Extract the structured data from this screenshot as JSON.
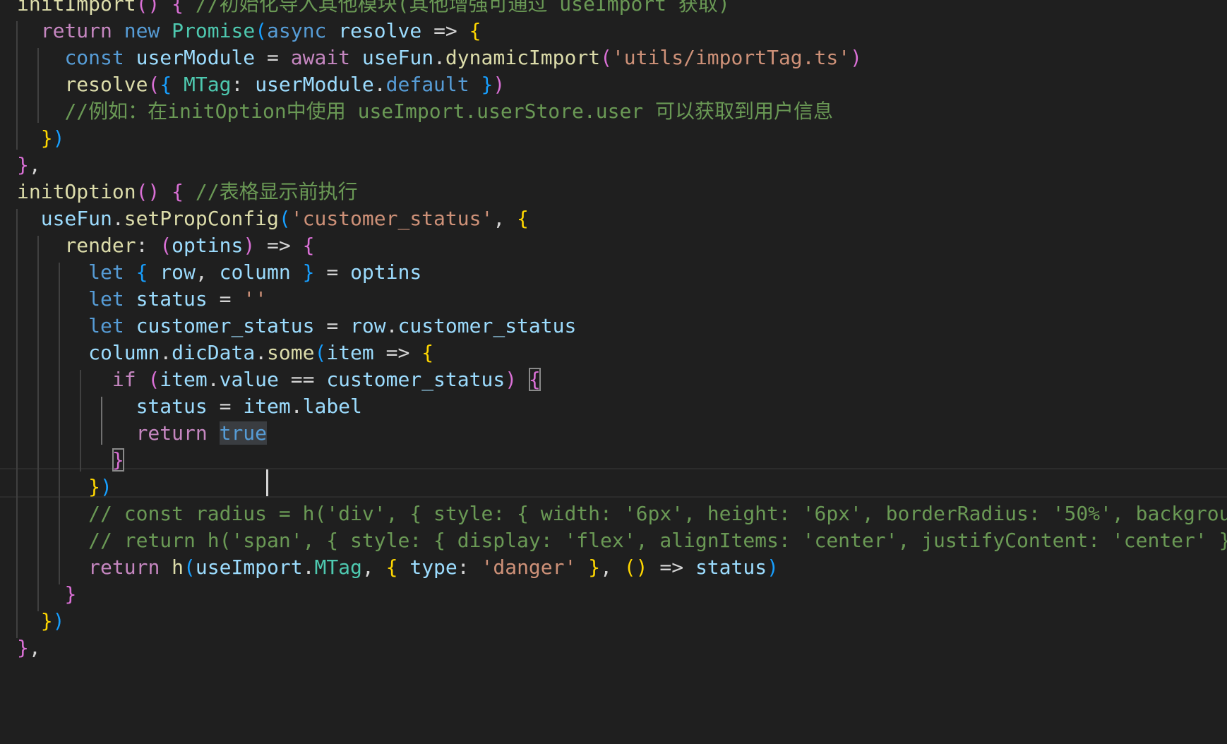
{
  "theme": {
    "background": "#1f1f1f",
    "colors": {
      "function": "#dcdcaa",
      "keyword": "#569cd6",
      "control": "#c586c0",
      "string": "#ce9178",
      "comment": "#6a9955",
      "variable": "#9cdcfe",
      "type": "#4ec9b0",
      "plain": "#d4d4d4",
      "bracket_level_1": "#ffd700",
      "bracket_level_2": "#da70d6",
      "bracket_level_3": "#179fff"
    }
  },
  "editor": {
    "active_line": 17,
    "selection": "true",
    "matched_bracket_lines": [
      15,
      18
    ],
    "lines": [
      [
        {
          "t": "initImport",
          "c": "fn"
        },
        {
          "t": "()",
          "c": "b2"
        },
        {
          "t": " "
        },
        {
          "t": "{",
          "c": "b2"
        },
        {
          "t": " "
        },
        {
          "t": "//初始化导入其他模块(其他增强可通过 useImport 获取)",
          "c": "cmt"
        }
      ],
      [
        {
          "t": "  "
        },
        {
          "t": "return",
          "c": "ctrl"
        },
        {
          "t": " "
        },
        {
          "t": "new",
          "c": "kw"
        },
        {
          "t": " "
        },
        {
          "t": "Promise",
          "c": "type"
        },
        {
          "t": "(",
          "c": "b3"
        },
        {
          "t": "async",
          "c": "kw"
        },
        {
          "t": " "
        },
        {
          "t": "resolve",
          "c": "var"
        },
        {
          "t": " => "
        },
        {
          "t": "{",
          "c": "b1"
        }
      ],
      [
        {
          "t": "    "
        },
        {
          "t": "const",
          "c": "kw"
        },
        {
          "t": " "
        },
        {
          "t": "userModule",
          "c": "var"
        },
        {
          "t": " = "
        },
        {
          "t": "await",
          "c": "ctrl"
        },
        {
          "t": " "
        },
        {
          "t": "useFun",
          "c": "var"
        },
        {
          "t": "."
        },
        {
          "t": "dynamicImport",
          "c": "fn"
        },
        {
          "t": "(",
          "c": "b2"
        },
        {
          "t": "'utils/importTag.ts'",
          "c": "str"
        },
        {
          "t": ")",
          "c": "b2"
        }
      ],
      [
        {
          "t": "    "
        },
        {
          "t": "resolve",
          "c": "fn"
        },
        {
          "t": "(",
          "c": "b2"
        },
        {
          "t": "{",
          "c": "b3"
        },
        {
          "t": " "
        },
        {
          "t": "MTag",
          "c": "type"
        },
        {
          "t": ": "
        },
        {
          "t": "userModule",
          "c": "var"
        },
        {
          "t": "."
        },
        {
          "t": "default",
          "c": "kw"
        },
        {
          "t": " "
        },
        {
          "t": "}",
          "c": "b3"
        },
        {
          "t": ")",
          "c": "b2"
        }
      ],
      [
        {
          "t": "    "
        },
        {
          "t": "//例如：在initOption中使用 useImport.userStore.user 可以获取到用户信息",
          "c": "cmt"
        }
      ],
      [
        {
          "t": "  "
        },
        {
          "t": "}",
          "c": "b1"
        },
        {
          "t": ")",
          "c": "b3"
        }
      ],
      [
        {
          "t": "}",
          "c": "b2"
        },
        {
          "t": ","
        }
      ],
      [
        {
          "t": "initOption",
          "c": "fn"
        },
        {
          "t": "()",
          "c": "b2"
        },
        {
          "t": " "
        },
        {
          "t": "{",
          "c": "b2"
        },
        {
          "t": " "
        },
        {
          "t": "//表格显示前执行",
          "c": "cmt"
        }
      ],
      [
        {
          "t": "  "
        },
        {
          "t": "useFun",
          "c": "var"
        },
        {
          "t": "."
        },
        {
          "t": "setPropConfig",
          "c": "fn"
        },
        {
          "t": "(",
          "c": "b3"
        },
        {
          "t": "'customer_status'",
          "c": "str"
        },
        {
          "t": ", "
        },
        {
          "t": "{",
          "c": "b1"
        }
      ],
      [
        {
          "t": "    "
        },
        {
          "t": "render",
          "c": "fn"
        },
        {
          "t": ": "
        },
        {
          "t": "(",
          "c": "b2"
        },
        {
          "t": "optins",
          "c": "var"
        },
        {
          "t": ")",
          "c": "b2"
        },
        {
          "t": " => "
        },
        {
          "t": "{",
          "c": "b2"
        }
      ],
      [
        {
          "t": "      "
        },
        {
          "t": "let",
          "c": "kw"
        },
        {
          "t": " "
        },
        {
          "t": "{",
          "c": "b3"
        },
        {
          "t": " "
        },
        {
          "t": "row",
          "c": "var"
        },
        {
          "t": ", "
        },
        {
          "t": "column",
          "c": "var"
        },
        {
          "t": " "
        },
        {
          "t": "}",
          "c": "b3"
        },
        {
          "t": " = "
        },
        {
          "t": "optins",
          "c": "var"
        }
      ],
      [
        {
          "t": "      "
        },
        {
          "t": "let",
          "c": "kw"
        },
        {
          "t": " "
        },
        {
          "t": "status",
          "c": "var"
        },
        {
          "t": " = "
        },
        {
          "t": "''",
          "c": "str"
        }
      ],
      [
        {
          "t": "      "
        },
        {
          "t": "let",
          "c": "kw"
        },
        {
          "t": " "
        },
        {
          "t": "customer_status",
          "c": "var"
        },
        {
          "t": " = "
        },
        {
          "t": "row",
          "c": "var"
        },
        {
          "t": "."
        },
        {
          "t": "customer_status",
          "c": "var"
        }
      ],
      [
        {
          "t": "      "
        },
        {
          "t": "column",
          "c": "var"
        },
        {
          "t": "."
        },
        {
          "t": "dicData",
          "c": "var"
        },
        {
          "t": "."
        },
        {
          "t": "some",
          "c": "fn"
        },
        {
          "t": "(",
          "c": "b3"
        },
        {
          "t": "item",
          "c": "var"
        },
        {
          "t": " => "
        },
        {
          "t": "{",
          "c": "b1"
        }
      ],
      [
        {
          "t": "        "
        },
        {
          "t": "if",
          "c": "ctrl"
        },
        {
          "t": " "
        },
        {
          "t": "(",
          "c": "b2"
        },
        {
          "t": "item",
          "c": "var"
        },
        {
          "t": "."
        },
        {
          "t": "value",
          "c": "var"
        },
        {
          "t": " == "
        },
        {
          "t": "customer_status",
          "c": "var"
        },
        {
          "t": ")",
          "c": "b2"
        },
        {
          "t": " "
        },
        {
          "t": "{",
          "c": "b2",
          "m": true
        }
      ],
      [
        {
          "t": "          "
        },
        {
          "t": "status",
          "c": "var"
        },
        {
          "t": " = "
        },
        {
          "t": "item",
          "c": "var"
        },
        {
          "t": "."
        },
        {
          "t": "label",
          "c": "var"
        }
      ],
      [
        {
          "t": "          "
        },
        {
          "t": "return",
          "c": "ctrl"
        },
        {
          "t": " "
        },
        {
          "t": "true",
          "c": "kw",
          "s": true
        }
      ],
      [
        {
          "t": "        "
        },
        {
          "t": "}",
          "c": "b2",
          "m": true
        }
      ],
      [
        {
          "t": "      "
        },
        {
          "t": "}",
          "c": "b1"
        },
        {
          "t": ")",
          "c": "b3"
        }
      ],
      [
        {
          "t": "      "
        },
        {
          "t": "// const radius = h('div', { style: { width: '6px', height: '6px', borderRadius: '50%', backgrou",
          "c": "cmt"
        }
      ],
      [
        {
          "t": "      "
        },
        {
          "t": "// return h('span', { style: { display: 'flex', alignItems: 'center', justifyContent: 'center' }",
          "c": "cmt"
        }
      ],
      [
        {
          "t": "      "
        },
        {
          "t": "return",
          "c": "ctrl"
        },
        {
          "t": " "
        },
        {
          "t": "h",
          "c": "fn"
        },
        {
          "t": "(",
          "c": "b3"
        },
        {
          "t": "useImport",
          "c": "var"
        },
        {
          "t": "."
        },
        {
          "t": "MTag",
          "c": "type"
        },
        {
          "t": ", "
        },
        {
          "t": "{",
          "c": "b1"
        },
        {
          "t": " "
        },
        {
          "t": "type",
          "c": "var"
        },
        {
          "t": ": "
        },
        {
          "t": "'danger'",
          "c": "str"
        },
        {
          "t": " "
        },
        {
          "t": "}",
          "c": "b1"
        },
        {
          "t": ", "
        },
        {
          "t": "()",
          "c": "b1"
        },
        {
          "t": " => "
        },
        {
          "t": "status",
          "c": "var"
        },
        {
          "t": ")",
          "c": "b3"
        }
      ],
      [
        {
          "t": "    "
        },
        {
          "t": "}",
          "c": "b2"
        }
      ],
      [
        {
          "t": "  "
        },
        {
          "t": "}",
          "c": "b1"
        },
        {
          "t": ")",
          "c": "b3"
        }
      ],
      [
        {
          "t": "}",
          "c": "b2"
        },
        {
          "t": ","
        }
      ]
    ]
  }
}
